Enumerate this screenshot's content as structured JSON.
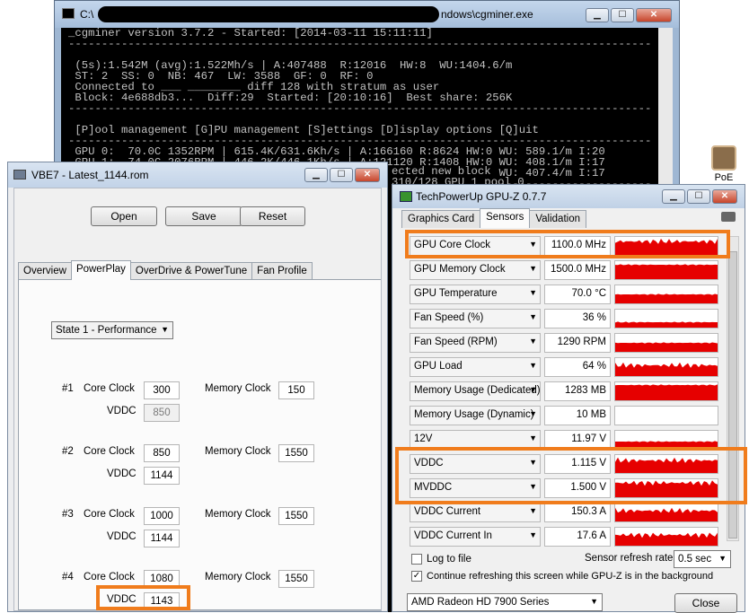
{
  "console": {
    "title_prefix": "C:\\",
    "title_suffix": "ndows\\cgminer.exe",
    "lines": [
      "_cgminer version 3.7.2 - Started: [2014-03-11 15:11:11]",
      "",
      " (5s):1.542M (avg):1.522Mh/s | A:407488  R:12016  HW:8  WU:1404.6/m",
      " ST: 2  SS: 0  NB: 467  LW: 3588  GF: 0  RF: 0",
      " Connected to ___ ________ diff 128 with stratum as user",
      " Block: 4e688db3...  Diff:29  Started: [20:10:16]  Best share: 256K",
      "",
      " [P]ool management [G]PU management [S]ettings [D]isplay options [Q]uit",
      " GPU 0:  70.0C 1352RPM | 615.4K/631.6Kh/s | A:166160 R:8624 HW:0 WU: 589.1/m I:20",
      " GPU 1:  74.0C 2076RPM | 446.2K/446.1Kh/s | A:121120 R:1408 HW:0 WU: 408.1/m I:17",
      " GPU 2:  73.0C 1414RPM | 444.9K/445.3Kh/s | A:120192 R:1984 HW:8 WU: 407.4/m I:17"
    ],
    "tail_lines": [
      "ected new block",
      "310/128 GPU 1 pool 0"
    ]
  },
  "desktop_icon": {
    "label": "PoE"
  },
  "vbe": {
    "title": "VBE7 - Latest_1144.rom",
    "buttons": {
      "open": "Open",
      "save": "Save",
      "reset": "Reset"
    },
    "tabs": [
      "Overview",
      "PowerPlay",
      "OverDrive & PowerTune",
      "Fan Profile"
    ],
    "active_tab": "PowerPlay",
    "state_select": "State 1 - Performance",
    "labels": {
      "core_clock": "Core Clock",
      "memory_clock": "Memory Clock",
      "vddc": "VDDC"
    },
    "states": [
      {
        "num": "#1",
        "core_clock": "300",
        "memory_clock": "150",
        "vddc": "850"
      },
      {
        "num": "#2",
        "core_clock": "850",
        "memory_clock": "1550",
        "vddc": "1144"
      },
      {
        "num": "#3",
        "core_clock": "1000",
        "memory_clock": "1550",
        "vddc": "1144"
      },
      {
        "num": "#4",
        "core_clock": "1080",
        "memory_clock": "1550",
        "vddc": "1143"
      }
    ]
  },
  "gpuz": {
    "title": "TechPowerUp GPU-Z 0.7.7",
    "tabs": [
      "Graphics Card",
      "Sensors",
      "Validation"
    ],
    "active_tab": "Sensors",
    "sensors": [
      {
        "name": "GPU Core Clock",
        "value": "1100.0 MHz",
        "level": 0.75
      },
      {
        "name": "GPU Memory Clock",
        "value": "1500.0 MHz",
        "level": 0.8
      },
      {
        "name": "GPU Temperature",
        "value": "70.0 °C",
        "level": 0.5
      },
      {
        "name": "Fan Speed (%)",
        "value": "36 %",
        "level": 0.3
      },
      {
        "name": "Fan Speed (RPM)",
        "value": "1290 RPM",
        "level": 0.5
      },
      {
        "name": "GPU Load",
        "value": "64 %",
        "level": 0.6
      },
      {
        "name": "Memory Usage (Dedicated)",
        "value": "1283 MB",
        "level": 0.85
      },
      {
        "name": "Memory Usage (Dynamic)",
        "value": "10 MB",
        "level": 0.0
      },
      {
        "name": "12V",
        "value": "11.97 V",
        "level": 0.4
      },
      {
        "name": "VDDC",
        "value": "1.115 V",
        "level": 0.7
      },
      {
        "name": "MVDDC",
        "value": "1.500 V",
        "level": 0.8
      },
      {
        "name": "VDDC Current",
        "value": "150.3 A",
        "level": 0.6
      },
      {
        "name": "VDDC Current In",
        "value": "17.6 A",
        "level": 0.6
      }
    ],
    "log_to_file": "Log to file",
    "refresh_label": "Sensor refresh rate:",
    "refresh_value": "0.5 sec",
    "continue_label": "Continue refreshing this screen while GPU-Z is in the background",
    "card": "AMD Radeon HD 7900 Series",
    "close": "Close"
  },
  "colors": {
    "highlight": "#f07c1c",
    "graph": "#e60000"
  }
}
